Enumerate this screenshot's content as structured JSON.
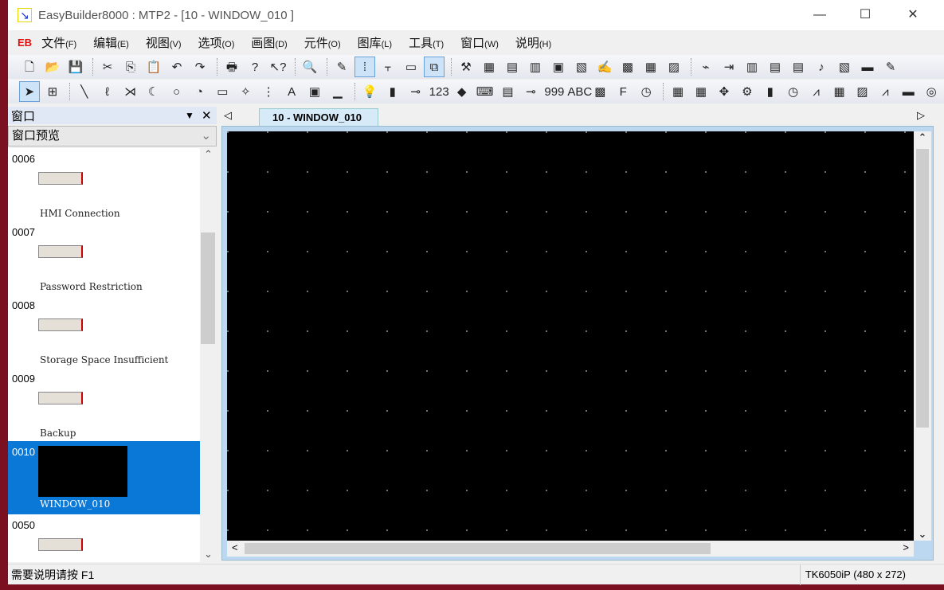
{
  "window": {
    "title": "EasyBuilder8000 : MTP2 - [10 - WINDOW_010 ]",
    "minimize": "—",
    "maximize": "☐",
    "close": "✕"
  },
  "menubar": {
    "logo": "EB",
    "items": [
      {
        "label": "文件",
        "key": "(F)"
      },
      {
        "label": "编辑",
        "key": "(E)"
      },
      {
        "label": "视图",
        "key": "(V)"
      },
      {
        "label": "选项",
        "key": "(O)"
      },
      {
        "label": "画图",
        "key": "(D)"
      },
      {
        "label": "元件",
        "key": "(O)"
      },
      {
        "label": "图库",
        "key": "(L)"
      },
      {
        "label": "工具",
        "key": "(T)"
      },
      {
        "label": "窗口",
        "key": "(W)"
      },
      {
        "label": "说明",
        "key": "(H)"
      }
    ],
    "mdi": [
      "–",
      "▫",
      "✕"
    ]
  },
  "toolbar1": [
    "new-icon",
    "open-icon",
    "save-icon",
    "|",
    "cut-icon",
    "copy-icon",
    "paste-icon",
    "undo-icon",
    "redo-icon",
    "|",
    "print-icon",
    "help-icon",
    "context-help-icon",
    "|",
    "find-icon",
    "|",
    "pen-icon",
    "grid-icon",
    "align-icon",
    "window-icon",
    "overlap-icon",
    "|",
    "tools-icon",
    "compile-icon",
    "simulate-icon",
    "download-icon",
    "online-icon",
    "macro-icon",
    "label-icon",
    "address-icon",
    "table-icon",
    "recipe-icon",
    "|",
    "plug-icon",
    "import-icon",
    "library-icon",
    "list-icon",
    "data-icon",
    "sound-icon",
    "report-icon",
    "message-icon",
    "edit-icon"
  ],
  "toolbar1_glyphs": [
    "🗋",
    "📂",
    "💾",
    "",
    "✂",
    "⎘",
    "📋",
    "↶",
    "↷",
    "",
    "🖶",
    "?",
    "↖?",
    "",
    "🔍",
    "",
    "✎",
    "⁞",
    "⫟",
    "▭",
    "⧉",
    "",
    "⚒",
    "▦",
    "▤",
    "▥",
    "▣",
    "▧",
    "✍",
    "▩",
    "▦",
    "▨",
    "",
    "⌁",
    "⇥",
    "▥",
    "▤",
    "▤",
    "♪",
    "▧",
    "▬",
    "✎"
  ],
  "toolbar2": [
    "select-icon",
    "property-icon",
    "|",
    "line-icon",
    "polyline-icon",
    "cross-icon",
    "arc-icon",
    "circle-icon",
    "pie-icon",
    "rectangle-icon",
    "star-icon",
    "scale-icon",
    "text-icon",
    "picture-icon",
    "frame-icon",
    "|",
    "bulb-icon",
    "lamp-icon",
    "bit-switch-icon",
    "numeric-icon",
    "word-icon",
    "keypad-icon",
    "input-icon",
    "slider-icon",
    "number-display-icon",
    "ascii-icon",
    "bitmap-icon",
    "function-key-icon",
    "clock-icon",
    "|",
    "alarm-icon",
    "event-icon",
    "move-icon",
    "animation-icon",
    "bar-chart-icon",
    "meter-icon",
    "trend-icon",
    "history-icon",
    "picture-view-icon",
    "xy-plot-icon",
    "combo-icon",
    "user-icon"
  ],
  "toolbar2_glyphs": [
    "➤",
    "⊞",
    "",
    "╲",
    "ℓ",
    "⋊",
    "☾",
    "○",
    "◔",
    "▭",
    "✧",
    "⋮",
    "A",
    "▣",
    "▁",
    "",
    "💡",
    "▮",
    "⊸",
    "123",
    "◆",
    "⌨",
    "▤",
    "⊸",
    "999",
    "ABC",
    "▩",
    "F",
    "◷",
    "",
    "▦",
    "▦",
    "✥",
    "⚙",
    "▮",
    "◷",
    "⩘",
    "▦",
    "▨",
    "⩘",
    "▬",
    "◎"
  ],
  "toolbar_active": [
    "grid-icon",
    "overlap-icon",
    "select-icon"
  ],
  "panel": {
    "title": "窗口",
    "pin": "▼",
    "close": "✕",
    "dropdown": "窗口预览",
    "dropdown_arrow": "⌄",
    "scroll_up": "⌃",
    "scroll_down": "⌄",
    "items": [
      {
        "num": "0006",
        "name": "HMI Connection"
      },
      {
        "num": "0007",
        "name": "Password Restriction"
      },
      {
        "num": "0008",
        "name": "Storage Space Insufficient"
      },
      {
        "num": "0009",
        "name": "Backup"
      },
      {
        "num": "0010",
        "name": "WINDOW_010",
        "selected": true
      },
      {
        "num": "0050",
        "name": ""
      }
    ]
  },
  "tabs": {
    "left": "◁",
    "right": "▷",
    "active": "10 - WINDOW_010",
    "close": "✕"
  },
  "canvas": {
    "background": "#000000",
    "scroll_up": "⌃",
    "scroll_down": "⌄",
    "scroll_left": "<",
    "scroll_right": ">"
  },
  "status": {
    "help": "需要说明请按 F1",
    "model": "TK6050iP (480 x 272)"
  },
  "colors": {
    "selection": "#0a78d7",
    "logo": "#e01010"
  }
}
